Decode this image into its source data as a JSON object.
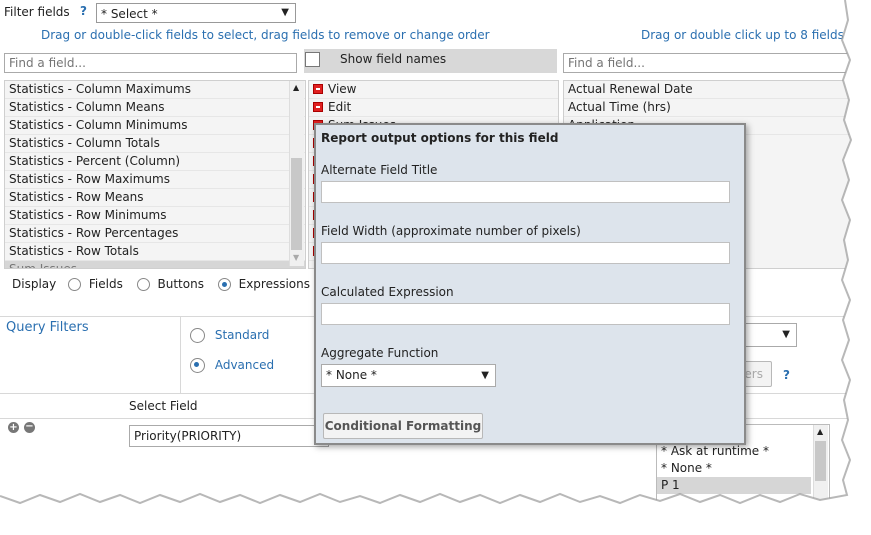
{
  "filter_bar": {
    "label": "Filter fields",
    "help": "?",
    "select_value": "* Select *"
  },
  "hints": {
    "left": "Drag or double-click fields to select, drag fields to remove or change order",
    "right": "Drag or double click up to 8 fields"
  },
  "search_left_placeholder": "Find a field...",
  "search_right_placeholder": "Find a field...",
  "show_field_names_label": "Show field names",
  "available_fields": [
    "Statistics - Column Maximums",
    "Statistics - Column Means",
    "Statistics - Column Minimums",
    "Statistics - Column Totals",
    "Statistics - Percent (Column)",
    "Statistics - Row Maximums",
    "Statistics - Row Means",
    "Statistics - Row Minimums",
    "Statistics - Row Percentages",
    "Statistics - Row Totals",
    "Sum Issues"
  ],
  "selected_fields": [
    "View",
    "Edit",
    "Sum Issues"
  ],
  "right_fields": [
    "Actual Renewal Date",
    "Actual Time (hrs)",
    "Application"
  ],
  "display": {
    "label": "Display",
    "options": [
      "Fields",
      "Buttons",
      "Expressions"
    ],
    "selected": "Expressions"
  },
  "query_filters": {
    "title": "Query Filters",
    "modes": [
      "Standard",
      "Advanced"
    ],
    "selected": "Advanced",
    "select_field_header": "Select Field",
    "field_value": "Priority(PRIORITY)",
    "help": "?",
    "buttons_partial": "ers",
    "values_list": [
      "* Ask at runtime *",
      "* None *",
      "P 1"
    ]
  },
  "dialog": {
    "title": "Report output options for this field",
    "alt_title_label": "Alternate Field Title",
    "width_label": "Field Width (approximate number of pixels)",
    "calc_label": "Calculated Expression",
    "agg_label": "Aggregate Function",
    "agg_value": "* None *",
    "conditional_button": "Conditional Formatting"
  }
}
